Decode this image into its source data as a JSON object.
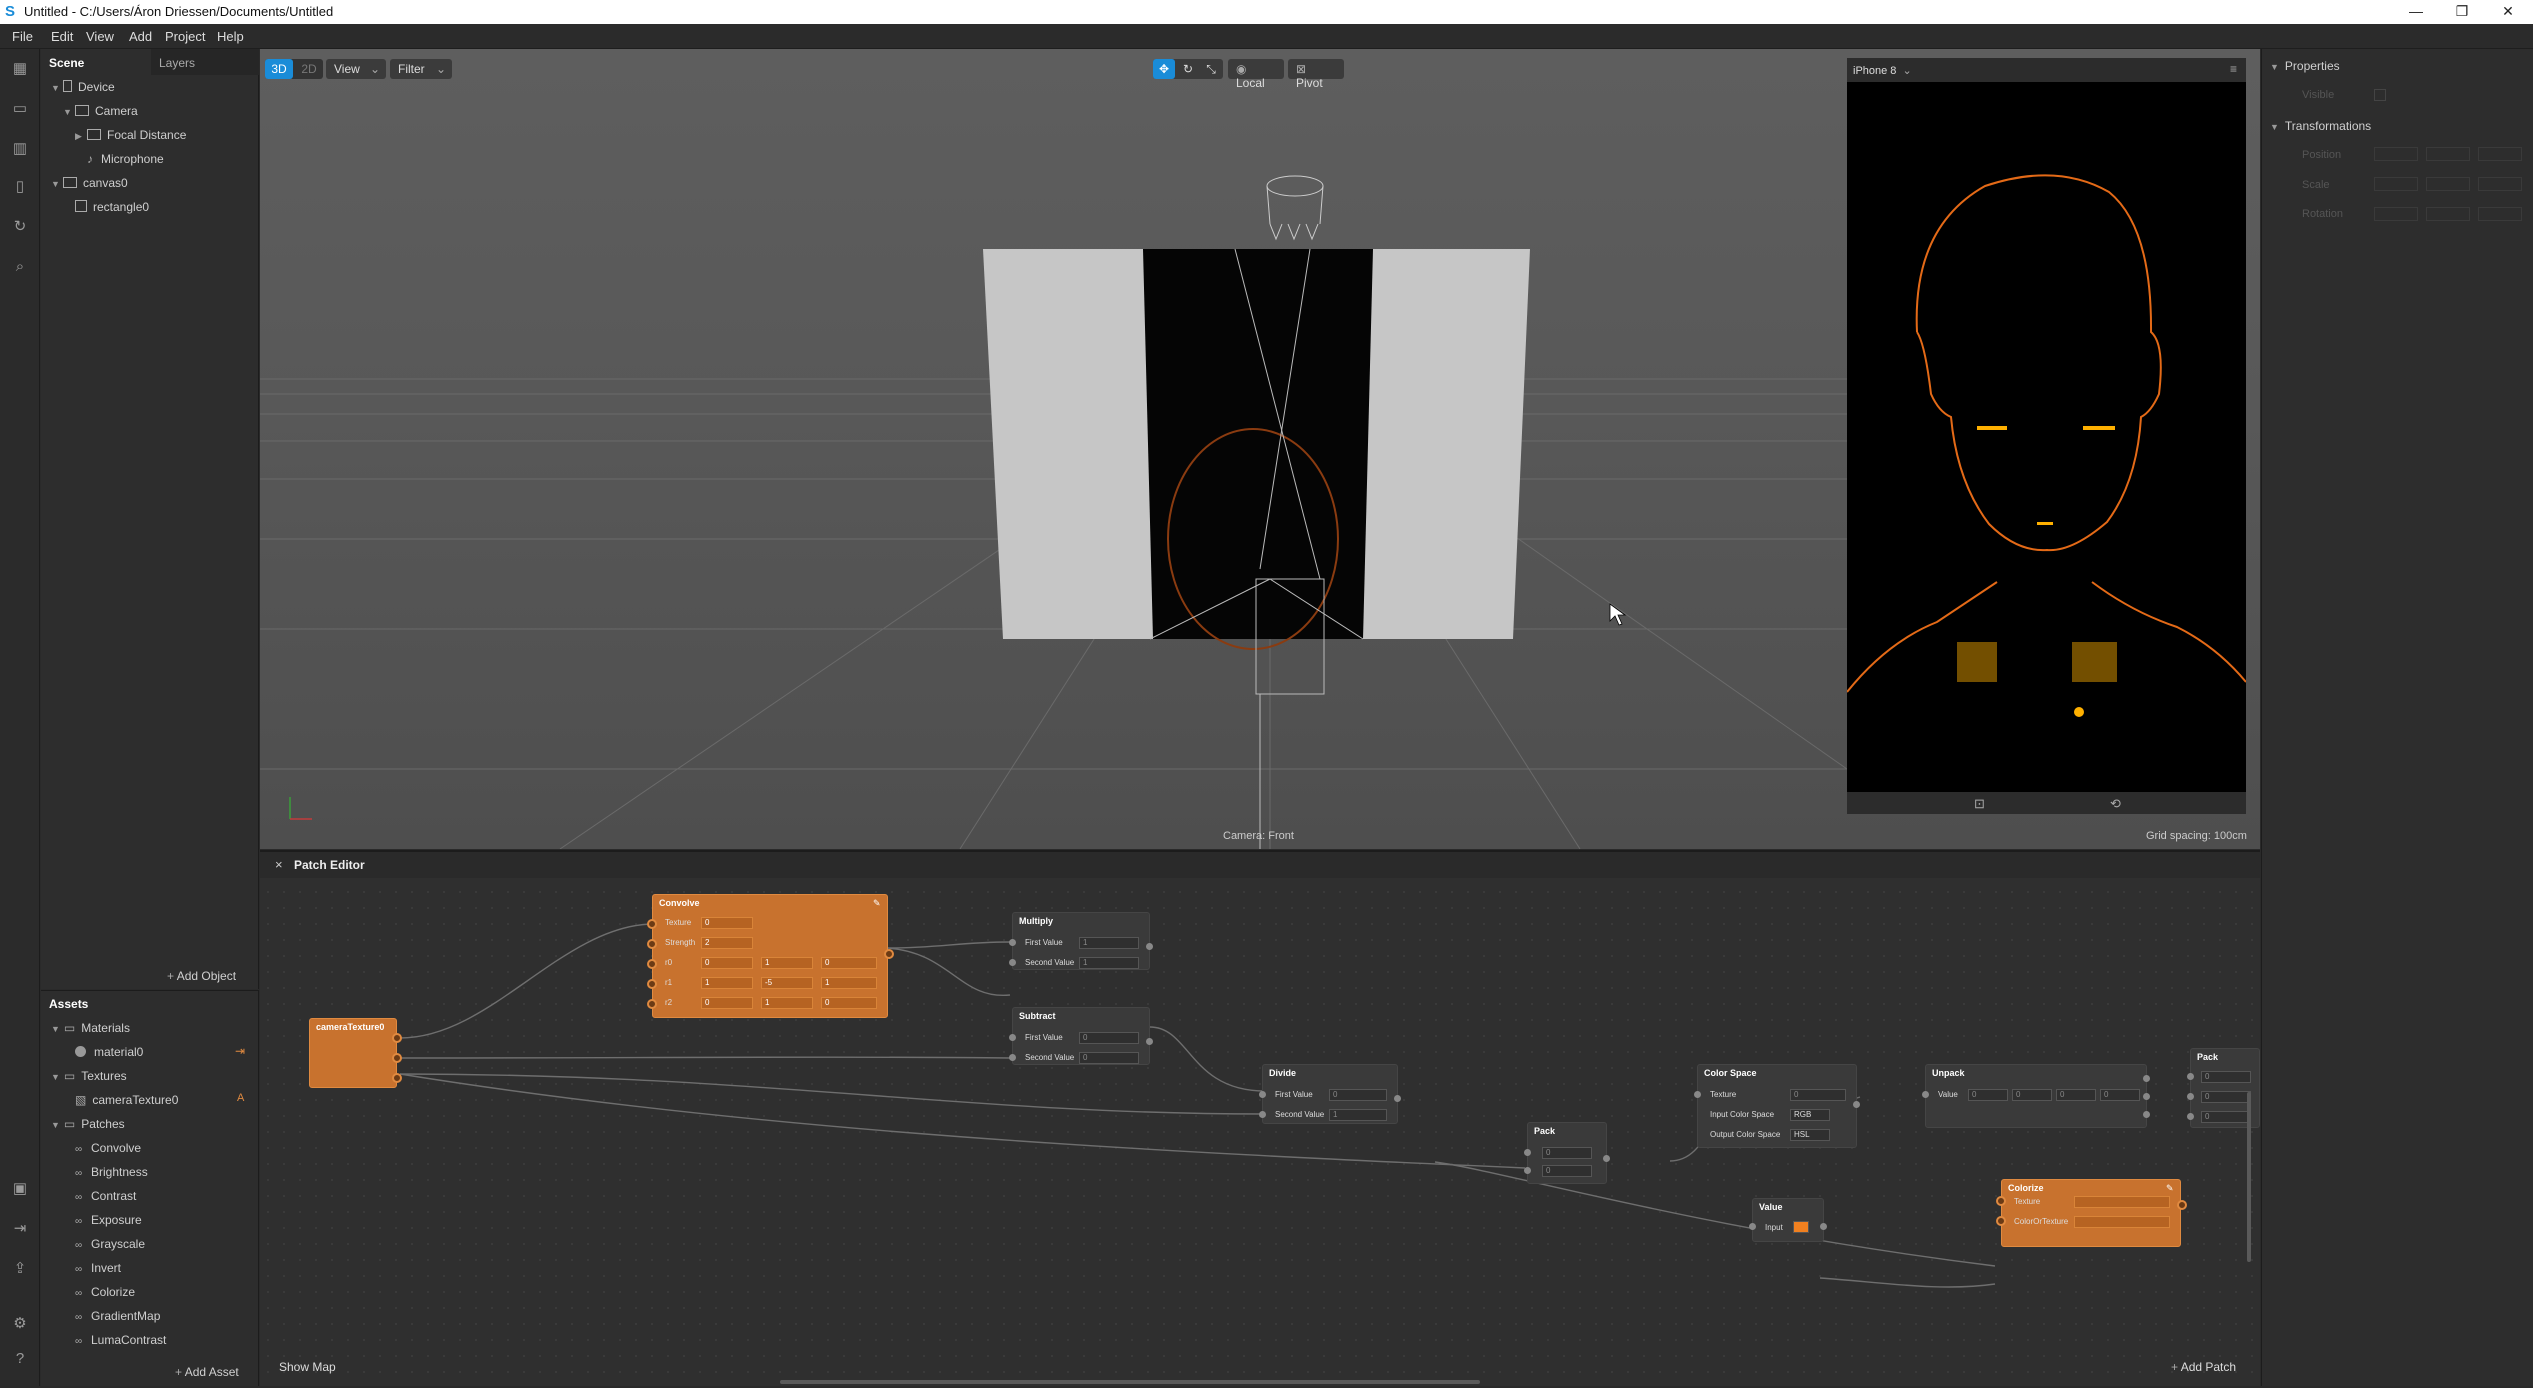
{
  "window": {
    "title": "Untitled - C:/Users/Áron Driessen/Documents/Untitled",
    "min": "—",
    "max": "❐",
    "close": "✕"
  },
  "menu": [
    "File",
    "Edit",
    "View",
    "Add",
    "Project",
    "Help"
  ],
  "scene": {
    "tabs": [
      "Scene",
      "Layers"
    ],
    "tree": [
      {
        "label": "Device"
      },
      {
        "label": "Camera"
      },
      {
        "label": "Focal Distance"
      },
      {
        "label": "Microphone"
      },
      {
        "label": "canvas0"
      },
      {
        "label": "rectangle0"
      }
    ],
    "add_object": "Add Object"
  },
  "assets": {
    "title": "Assets",
    "items": [
      {
        "label": "Materials"
      },
      {
        "label": "material0"
      },
      {
        "label": "Textures"
      },
      {
        "label": "cameraTexture0"
      },
      {
        "label": "Patches"
      },
      {
        "label": "Convolve"
      },
      {
        "label": "Brightness"
      },
      {
        "label": "Contrast"
      },
      {
        "label": "Exposure"
      },
      {
        "label": "Grayscale"
      },
      {
        "label": "Invert"
      },
      {
        "label": "Colorize"
      },
      {
        "label": "GradientMap"
      },
      {
        "label": "LumaContrast"
      }
    ],
    "add_asset": "Add Asset",
    "texture_badge": "A"
  },
  "viewport": {
    "mode_3d": "3D",
    "mode_2d": "2D",
    "view": "View",
    "filter": "Filter",
    "local": "Local",
    "pivot": "Pivot",
    "camera_label": "Camera: Front",
    "grid_spacing": "Grid spacing: 100cm"
  },
  "simulator": {
    "device": "iPhone 8"
  },
  "patch_editor": {
    "title": "Patch Editor",
    "close": "×",
    "show_map": "Show Map",
    "add_patch": "Add Patch",
    "nodes": {
      "convolve": {
        "title": "Convolve",
        "texture_label": "Texture",
        "texture_val": "0",
        "strength_label": "Strength",
        "strength_val": "2",
        "r0_label": "r0",
        "r1_label": "r1",
        "r2_label": "r2",
        "r0": [
          "0",
          "1",
          "0"
        ],
        "r1": [
          "1",
          "-5",
          "1"
        ],
        "r2": [
          "0",
          "1",
          "0"
        ]
      },
      "camera_texture": {
        "title": "cameraTexture0"
      },
      "multiply": {
        "title": "Multiply",
        "first": "First Value",
        "second": "Second Value",
        "first_val": "1",
        "second_val": "1"
      },
      "subtract": {
        "title": "Subtract",
        "first": "First Value",
        "second": "Second Value",
        "first_val": "0",
        "second_val": "0"
      },
      "divide": {
        "title": "Divide",
        "first": "First Value",
        "second": "Second Value",
        "first_val": "0",
        "second_val": "1"
      },
      "pack1": {
        "title": "Pack",
        "v1": "0",
        "v2": "0"
      },
      "color_space": {
        "title": "Color Space",
        "texture": "Texture",
        "texture_val": "0",
        "in_label": "Input Color Space",
        "in_val": "RGB",
        "out_label": "Output Color Space",
        "out_val": "HSL"
      },
      "unpack": {
        "title": "Unpack",
        "value": "Value",
        "vals": [
          "0",
          "0",
          "0",
          "0"
        ]
      },
      "pack2": {
        "title": "Pack",
        "vals": [
          "0",
          "0",
          "0"
        ]
      },
      "value": {
        "title": "Value",
        "input": "Input"
      },
      "colorize": {
        "title": "Colorize",
        "texture": "Texture",
        "color_texture": "ColorOrTexture"
      }
    }
  },
  "properties": {
    "title": "Properties",
    "visible": "Visible",
    "transformations": "Transformations",
    "position": "Position",
    "scale": "Scale",
    "rotation": "Rotation"
  },
  "colors": {
    "accent": "#1a8cd8",
    "node_orange": "#c8722e",
    "edge_glow": "#ff8c1a"
  }
}
